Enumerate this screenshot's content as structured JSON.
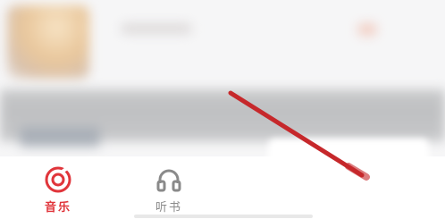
{
  "tabs": [
    {
      "label": "音乐",
      "icon": "music-disc-icon",
      "active": true
    },
    {
      "label": "听书",
      "icon": "headphones-icon",
      "active": false
    }
  ],
  "colors": {
    "accent": "#e0353b",
    "inactive": "#8a8a8a",
    "arrow": "#c6282b"
  }
}
